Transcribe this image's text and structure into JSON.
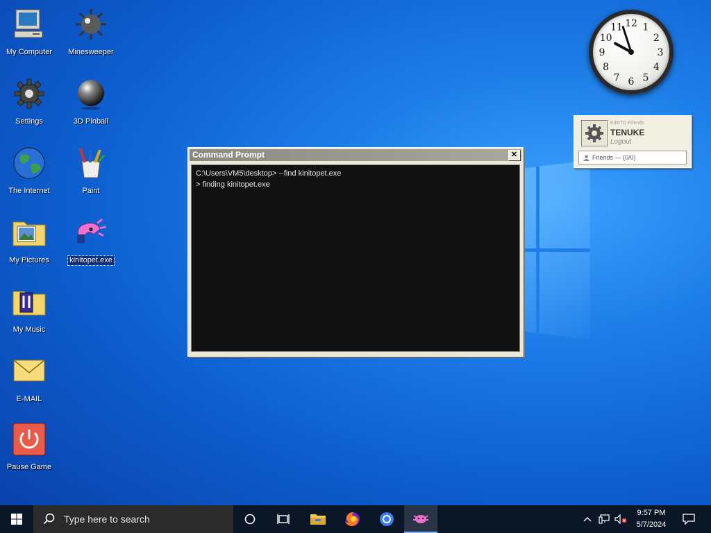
{
  "desktop": {
    "icons": [
      {
        "label": "My Computer",
        "icon": "computer-icon"
      },
      {
        "label": "Minesweeper",
        "icon": "mine-icon"
      },
      {
        "label": "Settings",
        "icon": "gear-icon"
      },
      {
        "label": "3D Pinball",
        "icon": "pinball-icon"
      },
      {
        "label": "The Internet",
        "icon": "globe-icon"
      },
      {
        "label": "Paint",
        "icon": "paint-icon"
      },
      {
        "label": "My Pictures",
        "icon": "folder-pictures-icon"
      },
      {
        "label": "kinitopet.exe",
        "icon": "kinitopet-icon"
      },
      {
        "label": "My Music",
        "icon": "folder-music-icon"
      },
      {
        "label": "E-MAIL",
        "icon": "envelope-icon"
      },
      {
        "label": "Pause Game",
        "icon": "power-icon"
      }
    ]
  },
  "clock": {
    "numbers": [
      "12",
      "1",
      "2",
      "3",
      "4",
      "5",
      "6",
      "7",
      "8",
      "9",
      "10",
      "11"
    ],
    "hour": 9,
    "minute": 57
  },
  "friends_widget": {
    "brand": "KINITO Friends",
    "username": "TENUKE",
    "logout": "Logout",
    "friends_label": "Friends — (0/0)"
  },
  "cmd_window": {
    "title": "Command Prompt",
    "close_label": "✕",
    "lines": [
      "C:\\Users\\VM5\\desktop> --find kinitopet.exe",
      "> finding kinitopet.exe"
    ]
  },
  "taskbar": {
    "search_placeholder": "Type here to search",
    "time": "9:57 PM",
    "date": "5/7/2024"
  },
  "colors": {
    "accent": "#0d5fd0",
    "taskbar": "#0b1626",
    "terminal_bg": "#121212"
  }
}
